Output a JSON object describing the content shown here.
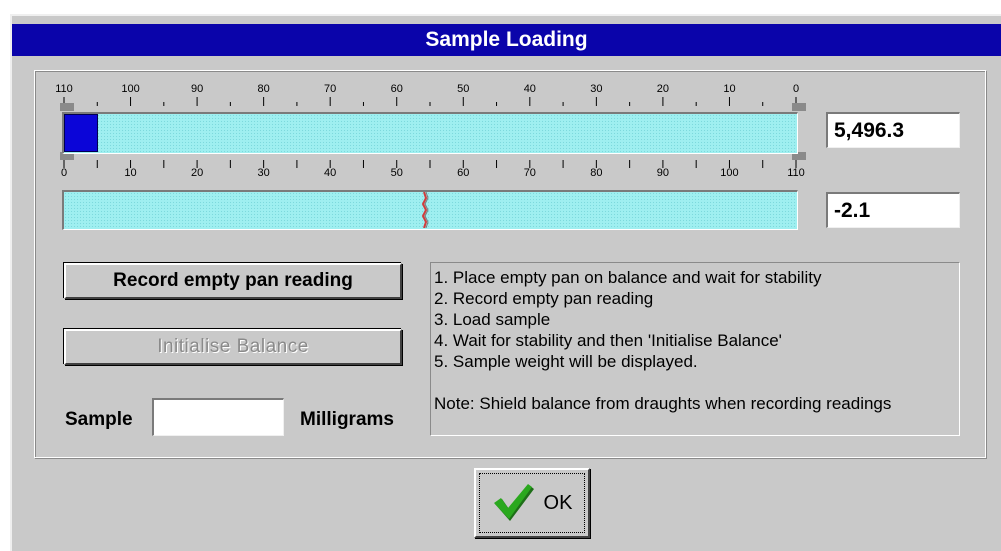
{
  "dialog": {
    "title": "Sample Loading"
  },
  "top_scale": {
    "labels": [
      "110",
      "100",
      "90",
      "80",
      "70",
      "60",
      "50",
      "40",
      "30",
      "20",
      "10",
      "0"
    ]
  },
  "bottom_scale": {
    "labels": [
      "0",
      "10",
      "20",
      "30",
      "40",
      "50",
      "60",
      "70",
      "80",
      "90",
      "100",
      "110"
    ]
  },
  "bar1": {
    "value": "5,496.3",
    "level_fraction": 0.045
  },
  "bar2": {
    "value": "-2.1",
    "needle_fraction": 0.49
  },
  "buttons": {
    "record": "Record empty pan reading",
    "initialise": "Initialise Balance",
    "ok": "OK"
  },
  "sample": {
    "label": "Sample",
    "units": "Milligrams",
    "value": ""
  },
  "instructions": [
    "1. Place empty pan on balance and wait for stability",
    "2. Record empty pan reading",
    "3. Load sample",
    "4. Wait for stability and then 'Initialise Balance'",
    "5. Sample weight will be displayed."
  ],
  "note": "Note: Shield balance from draughts when recording readings",
  "colors": {
    "title_bg": "#0a04aa",
    "bar_fill": "#9feff0",
    "indicator": "#0b05d8",
    "ok_check": "#2aa81e"
  }
}
